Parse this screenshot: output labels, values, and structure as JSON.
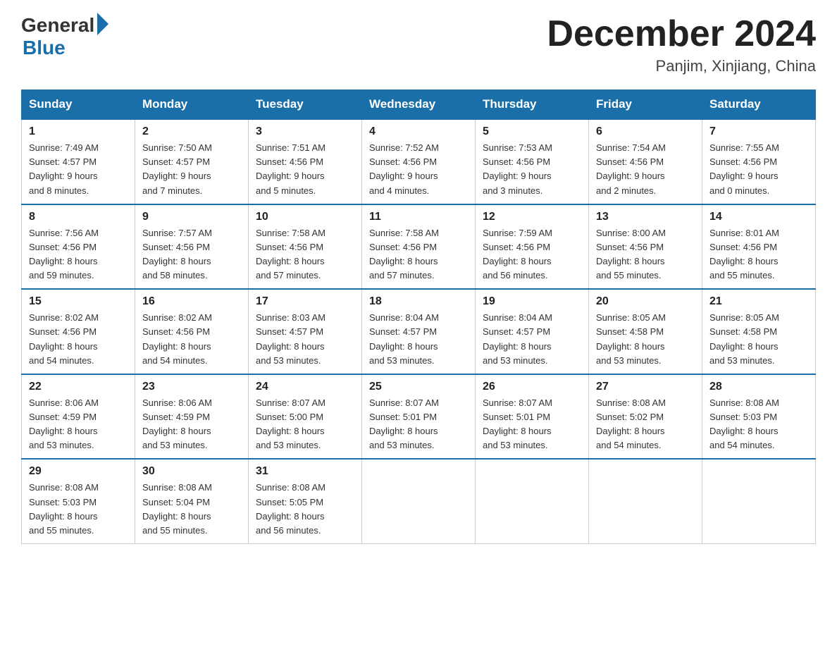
{
  "header": {
    "logo_general": "General",
    "logo_blue": "Blue",
    "month_title": "December 2024",
    "subtitle": "Panjim, Xinjiang, China"
  },
  "weekdays": [
    "Sunday",
    "Monday",
    "Tuesday",
    "Wednesday",
    "Thursday",
    "Friday",
    "Saturday"
  ],
  "weeks": [
    [
      {
        "day": "1",
        "info": "Sunrise: 7:49 AM\nSunset: 4:57 PM\nDaylight: 9 hours\nand 8 minutes."
      },
      {
        "day": "2",
        "info": "Sunrise: 7:50 AM\nSunset: 4:57 PM\nDaylight: 9 hours\nand 7 minutes."
      },
      {
        "day": "3",
        "info": "Sunrise: 7:51 AM\nSunset: 4:56 PM\nDaylight: 9 hours\nand 5 minutes."
      },
      {
        "day": "4",
        "info": "Sunrise: 7:52 AM\nSunset: 4:56 PM\nDaylight: 9 hours\nand 4 minutes."
      },
      {
        "day": "5",
        "info": "Sunrise: 7:53 AM\nSunset: 4:56 PM\nDaylight: 9 hours\nand 3 minutes."
      },
      {
        "day": "6",
        "info": "Sunrise: 7:54 AM\nSunset: 4:56 PM\nDaylight: 9 hours\nand 2 minutes."
      },
      {
        "day": "7",
        "info": "Sunrise: 7:55 AM\nSunset: 4:56 PM\nDaylight: 9 hours\nand 0 minutes."
      }
    ],
    [
      {
        "day": "8",
        "info": "Sunrise: 7:56 AM\nSunset: 4:56 PM\nDaylight: 8 hours\nand 59 minutes."
      },
      {
        "day": "9",
        "info": "Sunrise: 7:57 AM\nSunset: 4:56 PM\nDaylight: 8 hours\nand 58 minutes."
      },
      {
        "day": "10",
        "info": "Sunrise: 7:58 AM\nSunset: 4:56 PM\nDaylight: 8 hours\nand 57 minutes."
      },
      {
        "day": "11",
        "info": "Sunrise: 7:58 AM\nSunset: 4:56 PM\nDaylight: 8 hours\nand 57 minutes."
      },
      {
        "day": "12",
        "info": "Sunrise: 7:59 AM\nSunset: 4:56 PM\nDaylight: 8 hours\nand 56 minutes."
      },
      {
        "day": "13",
        "info": "Sunrise: 8:00 AM\nSunset: 4:56 PM\nDaylight: 8 hours\nand 55 minutes."
      },
      {
        "day": "14",
        "info": "Sunrise: 8:01 AM\nSunset: 4:56 PM\nDaylight: 8 hours\nand 55 minutes."
      }
    ],
    [
      {
        "day": "15",
        "info": "Sunrise: 8:02 AM\nSunset: 4:56 PM\nDaylight: 8 hours\nand 54 minutes."
      },
      {
        "day": "16",
        "info": "Sunrise: 8:02 AM\nSunset: 4:56 PM\nDaylight: 8 hours\nand 54 minutes."
      },
      {
        "day": "17",
        "info": "Sunrise: 8:03 AM\nSunset: 4:57 PM\nDaylight: 8 hours\nand 53 minutes."
      },
      {
        "day": "18",
        "info": "Sunrise: 8:04 AM\nSunset: 4:57 PM\nDaylight: 8 hours\nand 53 minutes."
      },
      {
        "day": "19",
        "info": "Sunrise: 8:04 AM\nSunset: 4:57 PM\nDaylight: 8 hours\nand 53 minutes."
      },
      {
        "day": "20",
        "info": "Sunrise: 8:05 AM\nSunset: 4:58 PM\nDaylight: 8 hours\nand 53 minutes."
      },
      {
        "day": "21",
        "info": "Sunrise: 8:05 AM\nSunset: 4:58 PM\nDaylight: 8 hours\nand 53 minutes."
      }
    ],
    [
      {
        "day": "22",
        "info": "Sunrise: 8:06 AM\nSunset: 4:59 PM\nDaylight: 8 hours\nand 53 minutes."
      },
      {
        "day": "23",
        "info": "Sunrise: 8:06 AM\nSunset: 4:59 PM\nDaylight: 8 hours\nand 53 minutes."
      },
      {
        "day": "24",
        "info": "Sunrise: 8:07 AM\nSunset: 5:00 PM\nDaylight: 8 hours\nand 53 minutes."
      },
      {
        "day": "25",
        "info": "Sunrise: 8:07 AM\nSunset: 5:01 PM\nDaylight: 8 hours\nand 53 minutes."
      },
      {
        "day": "26",
        "info": "Sunrise: 8:07 AM\nSunset: 5:01 PM\nDaylight: 8 hours\nand 53 minutes."
      },
      {
        "day": "27",
        "info": "Sunrise: 8:08 AM\nSunset: 5:02 PM\nDaylight: 8 hours\nand 54 minutes."
      },
      {
        "day": "28",
        "info": "Sunrise: 8:08 AM\nSunset: 5:03 PM\nDaylight: 8 hours\nand 54 minutes."
      }
    ],
    [
      {
        "day": "29",
        "info": "Sunrise: 8:08 AM\nSunset: 5:03 PM\nDaylight: 8 hours\nand 55 minutes."
      },
      {
        "day": "30",
        "info": "Sunrise: 8:08 AM\nSunset: 5:04 PM\nDaylight: 8 hours\nand 55 minutes."
      },
      {
        "day": "31",
        "info": "Sunrise: 8:08 AM\nSunset: 5:05 PM\nDaylight: 8 hours\nand 56 minutes."
      },
      {
        "day": "",
        "info": ""
      },
      {
        "day": "",
        "info": ""
      },
      {
        "day": "",
        "info": ""
      },
      {
        "day": "",
        "info": ""
      }
    ]
  ]
}
